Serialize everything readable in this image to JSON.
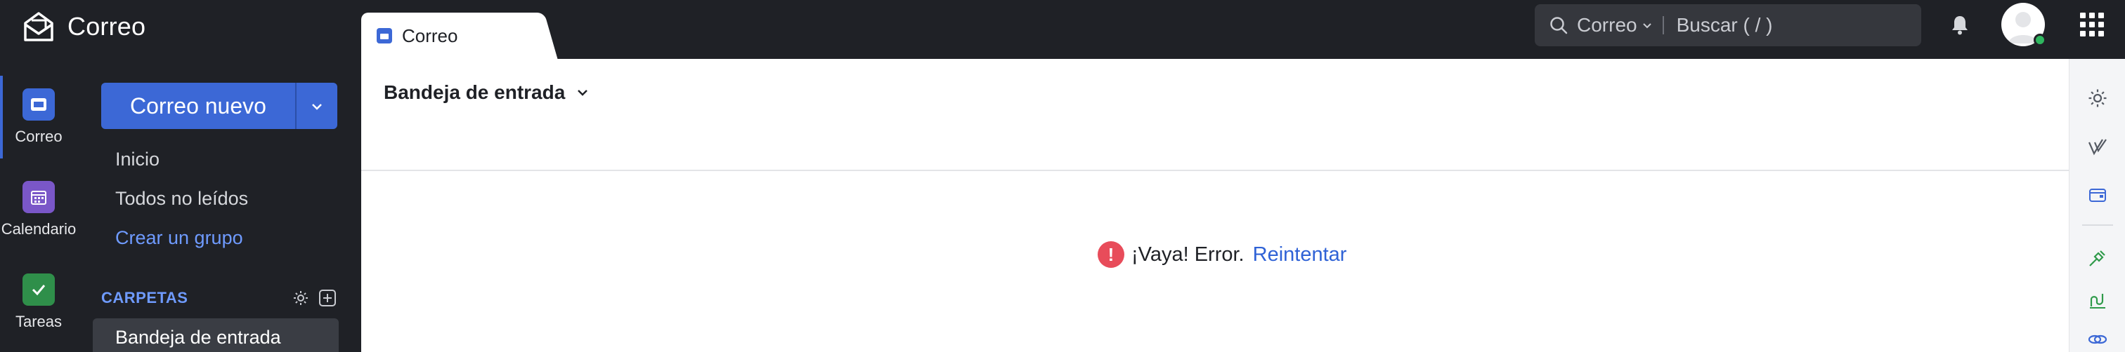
{
  "app": {
    "name": "Correo"
  },
  "tabs": [
    {
      "label": "Correo",
      "active": true
    }
  ],
  "search": {
    "scope": "Correo",
    "placeholder": "Buscar ( / )"
  },
  "rail": {
    "items": [
      {
        "label": "Correo",
        "icon": "mail-icon",
        "color": "#3c68d6",
        "active": true
      },
      {
        "label": "Calendario",
        "icon": "calendar-icon",
        "color": "#7a57c8",
        "active": false
      },
      {
        "label": "Tareas",
        "icon": "checkmark-icon",
        "color": "#2f8f4a",
        "active": false
      }
    ]
  },
  "sidebar": {
    "compose_label": "Correo nuevo",
    "links": [
      {
        "label": "Inicio"
      },
      {
        "label": "Todos no leídos"
      },
      {
        "label": "Crear un grupo",
        "accent": true
      }
    ],
    "folders_title": "CARPETAS",
    "active_folder": "Bandeja de entrada"
  },
  "main": {
    "view_title": "Bandeja de entrada",
    "error_text": "¡Vaya! Error.",
    "retry_label": "Reintentar"
  },
  "colors": {
    "accent": "#3c68d6",
    "error": "#e84c5a",
    "link": "#2f62d6",
    "presence": "#2fb65f"
  }
}
